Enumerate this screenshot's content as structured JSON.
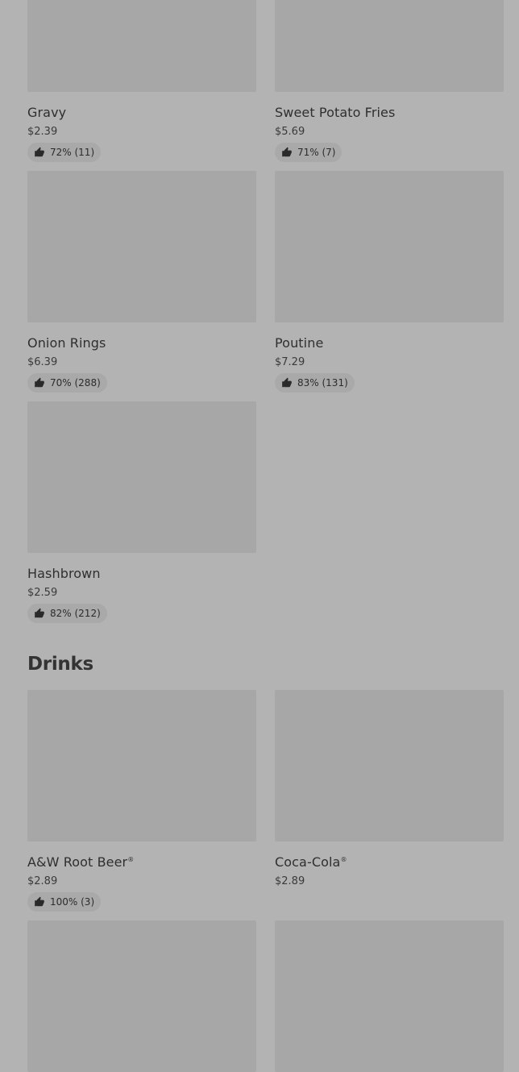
{
  "sides": {
    "items": [
      {
        "name": "Gravy",
        "price": "$2.39",
        "rating": "72% (11)"
      },
      {
        "name": "Sweet Potato Fries",
        "price": "$5.69",
        "rating": "71% (7)"
      },
      {
        "name": "Onion Rings",
        "price": "$6.39",
        "rating": "70% (288)"
      },
      {
        "name": "Poutine",
        "price": "$7.29",
        "rating": "83% (131)"
      },
      {
        "name": "Hashbrown",
        "price": "$2.59",
        "rating": "82% (212)"
      }
    ]
  },
  "drinks": {
    "title": "Drinks",
    "items": [
      {
        "name": "A&W Root Beer",
        "reg": "®",
        "price": "$2.89",
        "rating": "100% (3)"
      },
      {
        "name": "Coca-Cola",
        "reg": "®",
        "price": "$2.89"
      }
    ]
  },
  "icons": {
    "rating": "thumbs-up-icon"
  },
  "colors": {
    "background": "#b3b3b3",
    "image_placeholder": "#a7a7a7",
    "rating_pill": "#a9a9a9",
    "text": "#2f2f2f"
  }
}
